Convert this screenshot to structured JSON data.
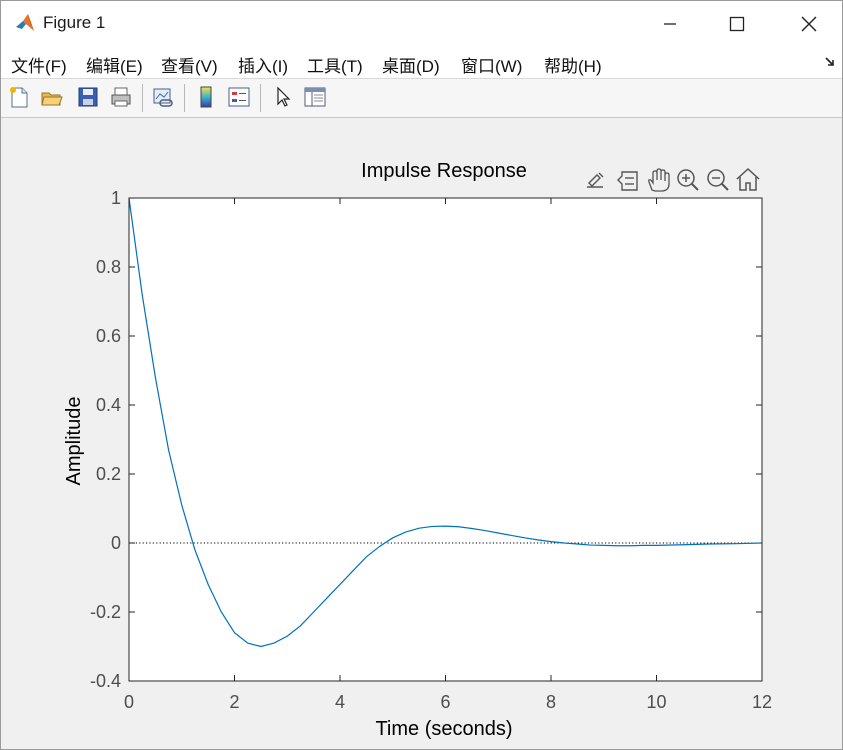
{
  "window": {
    "title": "Figure 1"
  },
  "menu": [
    {
      "label": "文件(F)"
    },
    {
      "label": "编辑(E)"
    },
    {
      "label": "查看(V)"
    },
    {
      "label": "插入(I)"
    },
    {
      "label": "工具(T)"
    },
    {
      "label": "桌面(D)"
    },
    {
      "label": "窗口(W)"
    },
    {
      "label": "帮助(H)"
    }
  ],
  "toolbar_icons": [
    "new-figure-icon",
    "open-file-icon",
    "save-icon",
    "print-icon",
    "link-plot-icon",
    "colorbar-icon",
    "legend-icon",
    "pointer-icon",
    "property-inspector-icon"
  ],
  "axes_toolbar_icons": [
    "brush-export-icon",
    "data-tips-icon",
    "pan-hand-icon",
    "zoom-in-icon",
    "zoom-out-icon",
    "home-icon"
  ],
  "colors": {
    "line": "#0072BD",
    "axes_bg": "#ffffff",
    "figure_bg": "#f0f0f0"
  },
  "chart_data": {
    "type": "line",
    "title": "Impulse Response",
    "xlabel": "Time (seconds)",
    "ylabel": "Amplitude",
    "xlim": [
      0,
      12
    ],
    "ylim": [
      -0.4,
      1
    ],
    "xticks": [
      "0",
      "2",
      "4",
      "6",
      "8",
      "10",
      "12"
    ],
    "yticks": [
      "-0.4",
      "-0.2",
      "0",
      "0.2",
      "0.4",
      "0.6",
      "0.8",
      "1"
    ],
    "reference_line": 0,
    "grid": false,
    "series": [
      {
        "x": [
          0,
          0.25,
          0.5,
          0.75,
          1,
          1.25,
          1.5,
          1.75,
          2,
          2.25,
          2.5,
          2.75,
          3,
          3.25,
          3.5,
          3.75,
          4,
          4.25,
          4.5,
          4.75,
          5,
          5.25,
          5.5,
          5.75,
          6,
          6.25,
          6.5,
          6.75,
          7,
          7.25,
          7.5,
          7.75,
          8,
          8.25,
          8.5,
          8.75,
          9,
          9.25,
          9.5,
          9.75,
          10,
          10.5,
          11,
          11.5,
          12
        ],
        "y": [
          1,
          0.72,
          0.48,
          0.27,
          0.11,
          -0.02,
          -0.12,
          -0.2,
          -0.26,
          -0.29,
          -0.3,
          -0.29,
          -0.27,
          -0.24,
          -0.2,
          -0.16,
          -0.12,
          -0.08,
          -0.04,
          -0.01,
          0.015,
          0.032,
          0.043,
          0.048,
          0.049,
          0.047,
          0.042,
          0.036,
          0.029,
          0.022,
          0.015,
          0.009,
          0.004,
          0,
          -0.003,
          -0.006,
          -0.007,
          -0.008,
          -0.008,
          -0.007,
          -0.007,
          -0.005,
          -0.003,
          -0.002,
          0
        ]
      }
    ]
  }
}
